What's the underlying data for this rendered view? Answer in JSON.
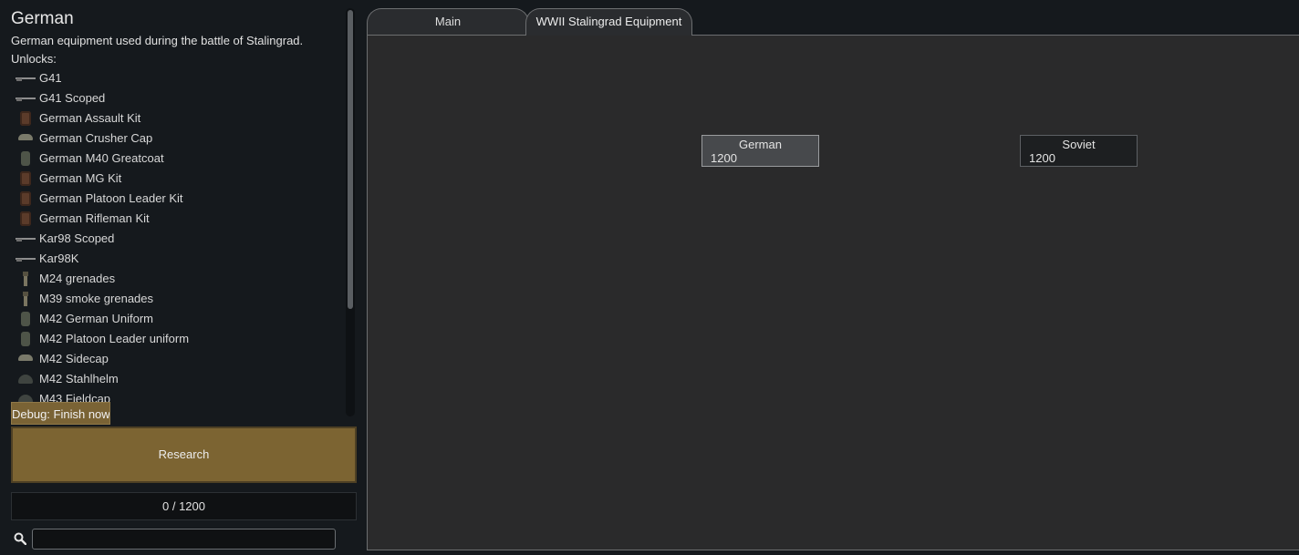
{
  "project": {
    "title": "German",
    "description": "German equipment used during the battle of Stalingrad.",
    "unlocks_label": "Unlocks:",
    "unlocks": [
      {
        "icon": "rifle-icon",
        "label": "G41"
      },
      {
        "icon": "rifle-icon",
        "label": "G41 Scoped"
      },
      {
        "icon": "kit-icon",
        "label": "German Assault Kit"
      },
      {
        "icon": "cap-icon",
        "label": "German Crusher Cap"
      },
      {
        "icon": "coat-icon",
        "label": "German M40 Greatcoat"
      },
      {
        "icon": "kit-icon",
        "label": "German MG Kit"
      },
      {
        "icon": "kit-icon",
        "label": "German Platoon Leader Kit"
      },
      {
        "icon": "kit-icon",
        "label": "German Rifleman Kit"
      },
      {
        "icon": "rifle-icon",
        "label": "Kar98 Scoped"
      },
      {
        "icon": "rifle-icon",
        "label": "Kar98K"
      },
      {
        "icon": "grenade-icon",
        "label": "M24 grenades"
      },
      {
        "icon": "grenade-icon",
        "label": "M39 smoke grenades"
      },
      {
        "icon": "coat-icon",
        "label": "M42 German Uniform"
      },
      {
        "icon": "coat-icon",
        "label": "M42 Platoon Leader uniform"
      },
      {
        "icon": "cap-icon",
        "label": "M42 Sidecap"
      },
      {
        "icon": "helmet-icon",
        "label": "M42 Stahlhelm"
      },
      {
        "icon": "helmet-icon",
        "label": "M43 Fieldcap"
      }
    ]
  },
  "buttons": {
    "debug_label": "Debug: Finish now",
    "research_label": "Research"
  },
  "progress": {
    "text": "0 / 1200"
  },
  "search": {
    "icon": "search-icon",
    "value": "",
    "placeholder": ""
  },
  "tabs": [
    {
      "label": "Main",
      "selected": false
    },
    {
      "label": "WWII Stalingrad Equipment",
      "selected": true
    }
  ],
  "nodes": [
    {
      "name": "German",
      "cost": "1200",
      "selected": true
    },
    {
      "name": "Soviet",
      "cost": "1200",
      "selected": false
    }
  ],
  "colors": {
    "research_button": "#7c6432",
    "panel_bg": "#15191d",
    "canvas_bg": "#2a2a2b"
  }
}
